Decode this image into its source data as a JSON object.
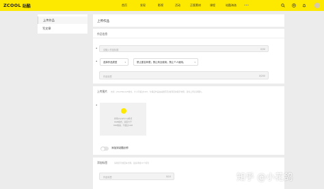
{
  "brand": {
    "name_en": "ZCOOL",
    "name_cn": "站酷"
  },
  "nav": [
    "首页",
    "发现",
    "影视",
    "活动",
    "正版素材",
    "课程",
    "站酷海洛",
    "•••"
  ],
  "sidebar": {
    "items": [
      "上传作品",
      "写文章"
    ]
  },
  "form": {
    "title": "上传作品",
    "section_info": "作品信息",
    "title_placeholder": "请输入作品标题",
    "title_count": "0/30",
    "type_select": "选择作品类型",
    "license_select": "禁止匿名转载；禁止商业使用；禁止个人使用。",
    "tags_placeholder": "作品标签",
    "tags_count": "0/200",
    "cover_label": "上传图片",
    "cover_hint": "支持：JPG/PNG/GIF格式，大小不超过10M，为保证作品在站酷首页/发现页的展示效果，建议上传高清图片。",
    "upload_line1": "支持jpg/gif/png格式",
    "upload_line2": "RGB模式，宽度大于",
    "upload_line3": "800像素，不超过10M",
    "toggle_label": "添加到站酷创作",
    "desc_label": "添加标签",
    "desc_hint": "请用逗号或回车分隔，最多添加10个标签",
    "desc_placeholder": "作品标签",
    "desc_count": "0/10"
  },
  "watermark": "知乎 @小花鸽",
  "colors": {
    "brand_yellow": "#fde800"
  }
}
